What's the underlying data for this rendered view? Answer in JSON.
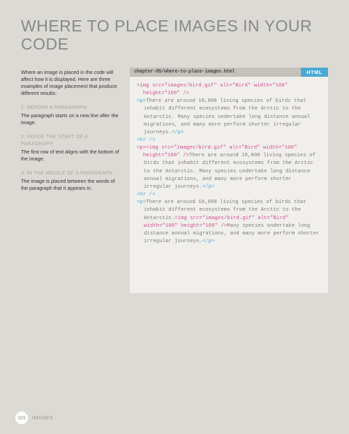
{
  "title": "WHERE TO PLACE IMAGES IN YOUR CODE",
  "intro": "Where an image is placed in the code will affect how it is displayed. Here are three examples of image placement that produce different results:",
  "sections": [
    {
      "heading": "1: BEFORE A PARAGRAPH",
      "desc": "The paragraph starts on a new line after the image."
    },
    {
      "heading": "2: INSIDE THE START OF A PARAGRAPH",
      "desc": "The first row of text aligns with the bottom of the image."
    },
    {
      "heading": "3: IN THE MIDDLE OF A PARAGRAPH",
      "desc": "The image is placed between the words of the paragraph that it appears in."
    }
  ],
  "file": {
    "path": "chapter-05/where-to-place-images.html",
    "tag": "HTML"
  },
  "code": {
    "l1a": "<img src=\"images/bird.gif\" alt=\"Bird\" width=\"100\"",
    "l1b": "  height=\"100\" />",
    "l2a": "<p>",
    "l2b": "There are around 10,000 living species of birds that inhabit different ecosystems from the Arctic to the Antarctic. Many species undertake long distance annual migrations, and many more perform shorter irregular journeys.",
    "l2c": "</p>",
    "l3": "<hr />",
    "l4a": "<p><img src=\"images/bird.gif\" alt=\"Bird\" width=\"100\"",
    "l4b": "  height=\"100\" />",
    "l4c": "There are around 10,000 living species of birds that inhabit different ecosystems from the Arctic to the Antarctic. Many species undertake long distance annual migrations, and many more perform shorter irregular journeys.",
    "l4d": "</p>",
    "l6a": "<p>",
    "l6b": "There are around 10,000 living species of birds that inhabit different ecosystems from the Arctic to the Antarctic.",
    "l6c": "<img src=\"images/bird.gif\" alt=\"Bird\" width=\"100\" height=\"100\" />",
    "l6d": "Many species undertake long distance annual migrations, and many more perform shorter irregular journeys.",
    "l6e": "</p>"
  },
  "footer": {
    "page": "101",
    "label": "IMAGES"
  }
}
